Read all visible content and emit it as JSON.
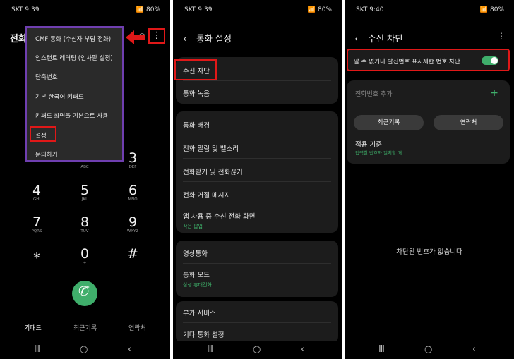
{
  "status": {
    "p1_time": "SKT 9:39",
    "p2_time": "SKT 9:39",
    "p3_time": "SKT 9:40",
    "battery": "80%"
  },
  "nav": {
    "recent": "Ⅲ",
    "home": "○",
    "back": "‹"
  },
  "p1": {
    "title": "전화",
    "more_icon": "⋮",
    "menu": [
      "CMF 통화 (수신자 부담 전화)",
      "인스턴트 레터링 (인사말 설정)",
      "단축번호",
      "기본 한국어 키패드",
      "키패드 화면을 기본으로 사용",
      "설정",
      "문의하기"
    ],
    "keys": [
      {
        "num": "3",
        "sub": "DEF"
      },
      {
        "num": "4",
        "sub": "GHI"
      },
      {
        "num": "5",
        "sub": "JKL"
      },
      {
        "num": "6",
        "sub": "MNO"
      },
      {
        "num": "7",
        "sub": "PQRS"
      },
      {
        "num": "8",
        "sub": "TUV"
      },
      {
        "num": "9",
        "sub": "WXYZ"
      },
      {
        "num": "⁎",
        "sub": ""
      },
      {
        "num": "0",
        "sub": "+"
      },
      {
        "num": "#",
        "sub": ""
      }
    ],
    "abc": "ABC",
    "call_badge": "HD",
    "tabs": [
      "키패드",
      "최근기록",
      "연락처"
    ]
  },
  "p2": {
    "header": "통화 설정",
    "back_icon": "‹",
    "group1": [
      "수신 차단",
      "통화 녹음"
    ],
    "group2": [
      {
        "label": "통화 배경",
        "sub": ""
      },
      {
        "label": "전화 알림 및 벨소리",
        "sub": ""
      },
      {
        "label": "전화받기 및 전화끊기",
        "sub": ""
      },
      {
        "label": "전화 거절 메시지",
        "sub": ""
      },
      {
        "label": "앱 사용 중 수신 전화 화면",
        "sub": "작은 팝업"
      }
    ],
    "group3": [
      {
        "label": "영상통화",
        "sub": ""
      },
      {
        "label": "통화 모드",
        "sub": "삼성 휴대전화"
      }
    ],
    "group4": [
      "부가 서비스",
      "기타 통화 설정"
    ]
  },
  "p3": {
    "header": "수신 차단",
    "back_icon": "‹",
    "more_icon": "⋮",
    "toggle_label": "알 수 없거나 발신번호 표시제한 번호 차단",
    "toggle_on": true,
    "add_placeholder": "전화번호 추가",
    "add_icon": "+",
    "recent_btn": "최근기록",
    "contacts_btn": "연락처",
    "apply_title": "적용 기준",
    "apply_sub": "입력한 번호와 일치할 때",
    "empty": "차단된 번호가 없습니다"
  },
  "colors": {
    "accent_green": "#3fae6b",
    "highlight_red": "#e01818",
    "menu_border": "#6f3fb0"
  }
}
